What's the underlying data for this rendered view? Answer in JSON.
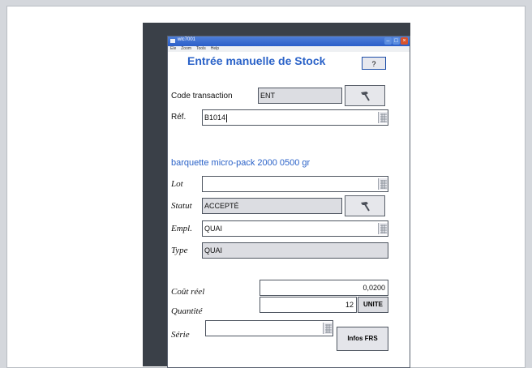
{
  "window": {
    "title": "wlc7001",
    "menu": [
      "Ele",
      "Zoom",
      "Tools",
      "Help"
    ]
  },
  "form": {
    "heading": "Entrée manuelle de Stock",
    "help_label": "?",
    "code_transaction": {
      "label": "Code transaction",
      "value": "ENT"
    },
    "ref": {
      "label": "Réf.",
      "value": "B1014"
    },
    "description": "barquette micro-pack 2000 0500 gr",
    "lot": {
      "label": "Lot",
      "value": ""
    },
    "statut": {
      "label": "Statut",
      "value": "ACCEPTÉ"
    },
    "empl": {
      "label": "Empl.",
      "value": "QUAI"
    },
    "type": {
      "label": "Type",
      "value": "QUAI"
    },
    "cout_reel": {
      "label": "Coût réel",
      "value": "0,0200"
    },
    "quantite": {
      "label": "Quantité",
      "value": "12",
      "unit": "UNITE"
    },
    "serie": {
      "label": "Série",
      "value": ""
    },
    "infos_button": "Infos FRS"
  },
  "colors": {
    "accent": "#2a62c8",
    "titlebar": "#2a5ec9",
    "readonly_field": "#dcdde2"
  }
}
